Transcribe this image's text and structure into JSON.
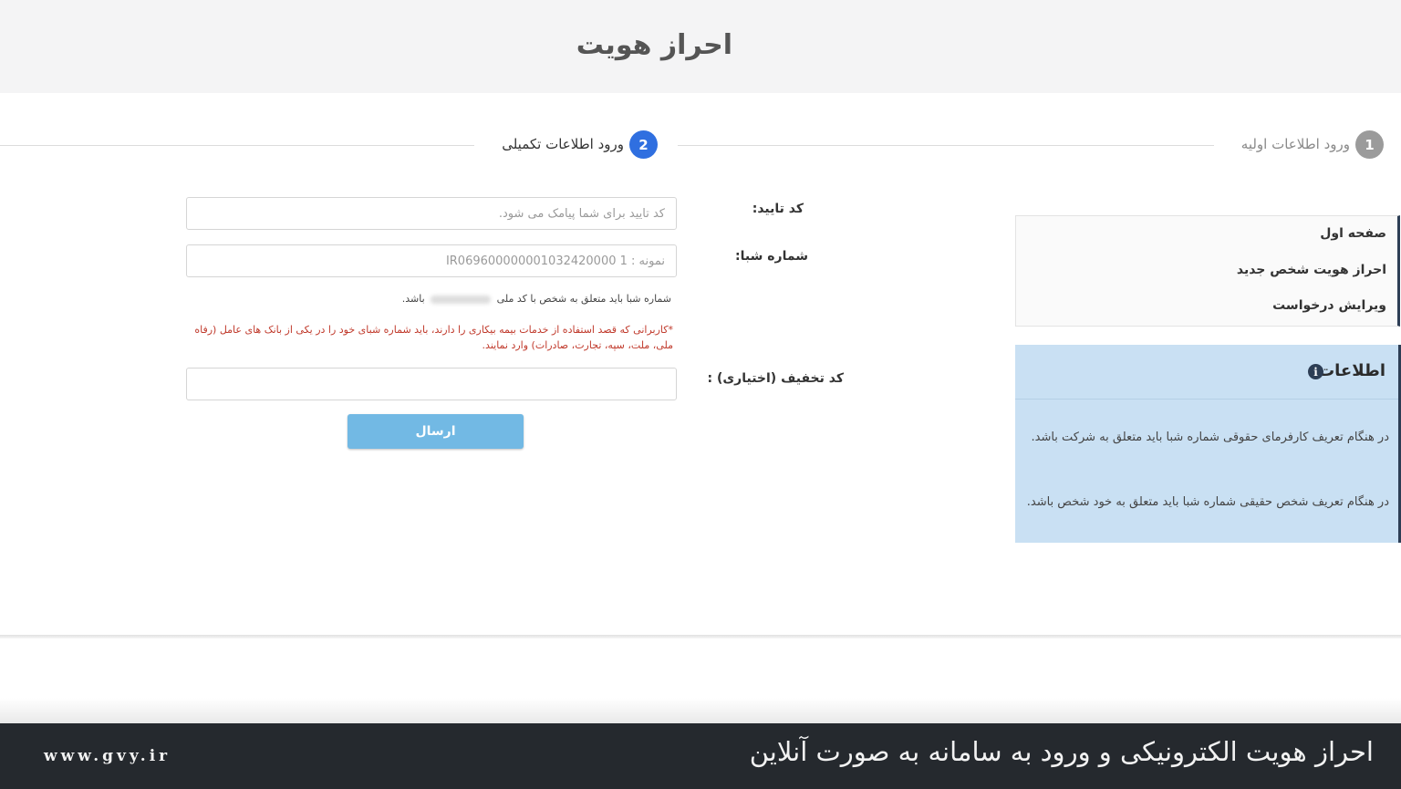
{
  "header": {
    "title": "احراز هویت"
  },
  "steps": [
    {
      "number": "1",
      "label": "ورود اطلاعات اولیه",
      "state": "done"
    },
    {
      "number": "2",
      "label": "ورود اطلاعات تکمیلی",
      "state": "active"
    }
  ],
  "sidebar": {
    "items": [
      {
        "label": "صفحه اول"
      },
      {
        "label": "احراز هویت شخص جدید"
      },
      {
        "label": "ویرایش درخواست"
      }
    ]
  },
  "info": {
    "title": "اطلاعات",
    "icon": "info-icon",
    "paragraphs": [
      "در هنگام تعریف کارفرمای حقوقی شماره شبا باید متعلق به شرکت باشد.",
      "در هنگام تعریف شخص حقیقی شماره شبا باید متعلق به خود شخص باشد."
    ]
  },
  "form": {
    "verify_code": {
      "label": "کد تایید:",
      "placeholder": "کد تایید برای شما پیامک می شود.",
      "value": ""
    },
    "sheba": {
      "label": "شماره شبا:",
      "placeholder": "نمونه : IR069600000001032420000 1",
      "value": ""
    },
    "sheba_help_before": "شماره شبا باید متعلق به شخص با کد ملی",
    "sheba_help_after": "باشد.",
    "warning": "*کاربرانی که قصد استفاده از خدمات بیمه بیکاری را دارند، باید شماره شبای خود را در یکی از بانک های عامل (رفاه ملی، ملت، سپه، تجارت، صادرات) وارد نمایند.",
    "discount": {
      "label": "کد تخفیف (اختیاری) :",
      "placeholder": "",
      "value": ""
    },
    "submit_label": "ارسال"
  },
  "caption": {
    "text": "احراز هویت الکترونیکی و ورود به سامانه به صورت آنلاین",
    "site": "www.gvy.ir"
  },
  "colors": {
    "step_active": "#2f6fe0",
    "step_done": "#9b9b9b",
    "button": "#72b9e4",
    "info_bg": "#c9e0f3",
    "warning": "#c0392b"
  }
}
